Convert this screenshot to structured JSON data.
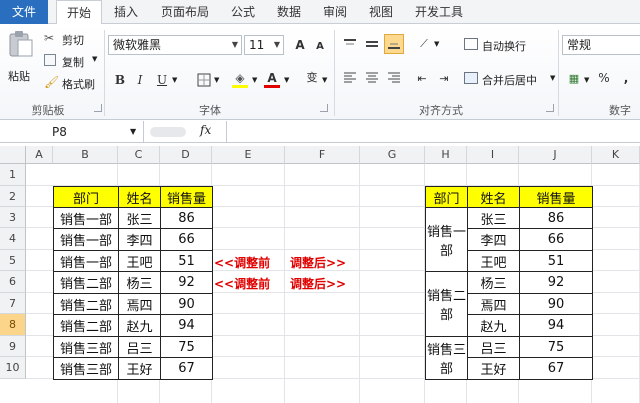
{
  "tabs": {
    "file": "文件",
    "home": "开始",
    "insert": "插入",
    "layout": "页面布局",
    "formula": "公式",
    "data": "数据",
    "review": "审阅",
    "view": "视图",
    "dev": "开发工具"
  },
  "clipboard": {
    "paste": "粘贴",
    "cut": "剪切",
    "copy": "复制",
    "format_painter": "格式刷",
    "label": "剪贴板"
  },
  "font": {
    "name": "微软雅黑",
    "size": "11",
    "label": "字体",
    "bold": "B",
    "italic": "I",
    "underline": "U",
    "grow": "A",
    "shrink": "A",
    "font_color_glyph": "A",
    "highlight_glyph": "A",
    "wen": "wén",
    "wen_char": "变"
  },
  "alignment": {
    "wrap": "自动换行",
    "merge": "合并后居中",
    "label": "对齐方式"
  },
  "number": {
    "format": "常规",
    "percent": "%",
    "comma": ",",
    "label": "数字"
  },
  "formula_bar": {
    "name_box": "P8",
    "fx": "fx"
  },
  "columns": [
    "A",
    "B",
    "C",
    "D",
    "E",
    "F",
    "G",
    "H",
    "I",
    "J",
    "K"
  ],
  "rows": [
    "1",
    "2",
    "3",
    "4",
    "5",
    "6",
    "7",
    "8",
    "9",
    "10"
  ],
  "left_table": {
    "headers": [
      "部门",
      "姓名",
      "销售量"
    ],
    "rows": [
      [
        "销售一部",
        "张三",
        "86"
      ],
      [
        "销售一部",
        "李四",
        "66"
      ],
      [
        "销售一部",
        "王吧",
        "51"
      ],
      [
        "销售二部",
        "杨三",
        "92"
      ],
      [
        "销售二部",
        "焉四",
        "90"
      ],
      [
        "销售二部",
        "赵九",
        "94"
      ],
      [
        "销售三部",
        "吕三",
        "75"
      ],
      [
        "销售三部",
        "王好",
        "67"
      ]
    ]
  },
  "annotations": {
    "before": "<<调整前",
    "after": "调整后>>"
  },
  "right_table": {
    "headers": [
      "部门",
      "姓名",
      "销售量"
    ],
    "groups": [
      "销售一部",
      "销售二部",
      "销售三部"
    ],
    "names": [
      "张三",
      "李四",
      "王吧",
      "杨三",
      "焉四",
      "赵九",
      "吕三",
      "王好"
    ],
    "values": [
      "86",
      "66",
      "51",
      "92",
      "90",
      "94",
      "75",
      "67"
    ]
  },
  "colors": {
    "header_fill": "#ffff00",
    "annotation": "#e00000",
    "file_tab": "#2a6fbf"
  }
}
